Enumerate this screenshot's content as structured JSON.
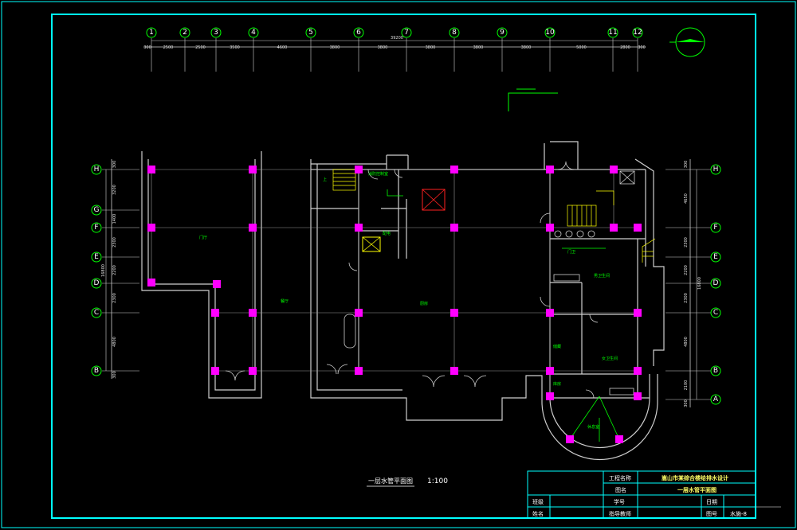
{
  "drawing": {
    "caption": "一层水管平面图",
    "scale": "1:100",
    "total_width_dim": "39200"
  },
  "top_axes": [
    "1",
    "2",
    "3",
    "4",
    "5",
    "6",
    "7",
    "8",
    "9",
    "10",
    "11",
    "12"
  ],
  "top_dims": [
    "300",
    "2500",
    "2500",
    "3500",
    "4600",
    "3800",
    "3800",
    "3800",
    "3800",
    "3800",
    "5000",
    "2800",
    "300"
  ],
  "left_axes": [
    "H",
    "G",
    "F",
    "E",
    "D",
    "C",
    "B"
  ],
  "left_dims": [
    "300",
    "3200",
    "1400",
    "2300",
    "2200",
    "2300",
    "4800",
    "300"
  ],
  "left_total": "16800",
  "right_axes": [
    "H",
    "F",
    "E",
    "D",
    "C",
    "B",
    "A"
  ],
  "right_dims": [
    "300",
    "4650",
    "2300",
    "2200",
    "2300",
    "4800",
    "2100",
    "300"
  ],
  "right_total": "16800",
  "rooms": [
    {
      "label": "门厅"
    },
    {
      "label": "餐厅"
    },
    {
      "label": "厨房"
    },
    {
      "label": "消防控制室"
    },
    {
      "label": "配电"
    },
    {
      "label": "男卫生间"
    },
    {
      "label": "女卫生间"
    },
    {
      "label": "储藏"
    },
    {
      "label": "库房"
    },
    {
      "label": "休息室"
    },
    {
      "label": "门卫"
    },
    {
      "label": "上"
    }
  ],
  "title_block": {
    "project_name_label": "工程名称",
    "project_name": "嵩山市某综合楼给排水设计",
    "drawing_name_label": "图名",
    "drawing_name": "一层水管平面图",
    "class_label": "班级",
    "student_no_label": "学号",
    "date_label": "日期",
    "name_label": "姓名",
    "instructor_label": "指导教师",
    "sheet_no_label": "图号",
    "sheet_no": "水施-8"
  }
}
